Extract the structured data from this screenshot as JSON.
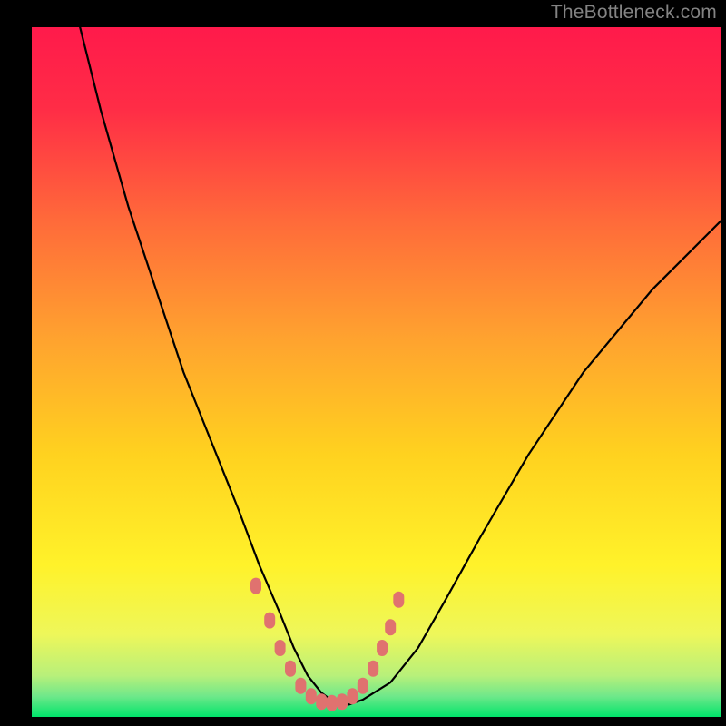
{
  "watermark": "TheBottleneck.com",
  "chart_data": {
    "type": "line",
    "title": "",
    "xlabel": "",
    "ylabel": "",
    "xlim": [
      0,
      100
    ],
    "ylim": [
      0,
      100
    ],
    "grid": false,
    "background_gradient_top": "#ff1a4b",
    "background_gradient_mid": "#ffd400",
    "background_gradient_bottom": "#00e46a",
    "series": [
      {
        "name": "curve",
        "color": "#000000",
        "x": [
          7,
          10,
          14,
          18,
          22,
          26,
          30,
          33,
          36,
          38,
          40,
          42,
          44,
          46,
          48,
          52,
          56,
          60,
          65,
          72,
          80,
          90,
          100
        ],
        "y": [
          100,
          88,
          74,
          62,
          50,
          40,
          30,
          22,
          15,
          10,
          6,
          3.5,
          2,
          1.8,
          2.5,
          5,
          10,
          17,
          26,
          38,
          50,
          62,
          72
        ]
      },
      {
        "name": "marker-band",
        "type": "scatter",
        "color": "#e0726f",
        "x": [
          32.5,
          34.5,
          36,
          37.5,
          39,
          40.5,
          42,
          43.5,
          45,
          46.5,
          48,
          49.5,
          50.8,
          52,
          53.2
        ],
        "y": [
          19,
          14,
          10,
          7,
          4.5,
          3,
          2.2,
          2,
          2.2,
          3,
          4.5,
          7,
          10,
          13,
          17
        ]
      }
    ]
  }
}
